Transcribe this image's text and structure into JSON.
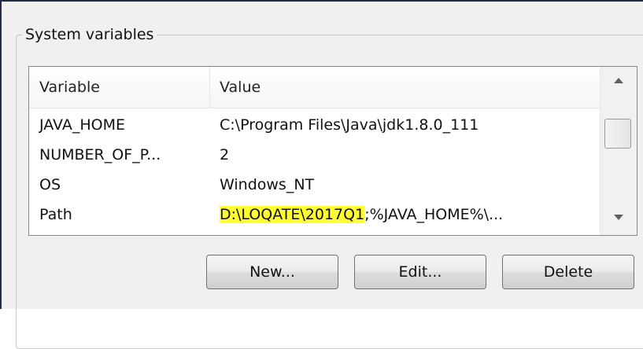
{
  "group": {
    "title": "System variables"
  },
  "list": {
    "columns": [
      "Variable",
      "Value"
    ],
    "rows": [
      {
        "variable": "JAVA_HOME",
        "value": "C:\\Program Files\\Java\\jdk1.8.0_111"
      },
      {
        "variable": "NUMBER_OF_P...",
        "value": "2"
      },
      {
        "variable": "OS",
        "value": "Windows_NT"
      },
      {
        "variable": "Path",
        "value_highlight": "D:\\LOQATE\\2017Q1",
        "value_rest": ";%JAVA_HOME%\\..."
      }
    ],
    "highlight_color": "#ffff33"
  },
  "buttons": {
    "new": "New...",
    "edit": "Edit...",
    "delete": "Delete"
  },
  "icons": {
    "scroll_up": "scroll-up-arrow-icon",
    "scroll_down": "scroll-down-arrow-icon"
  }
}
